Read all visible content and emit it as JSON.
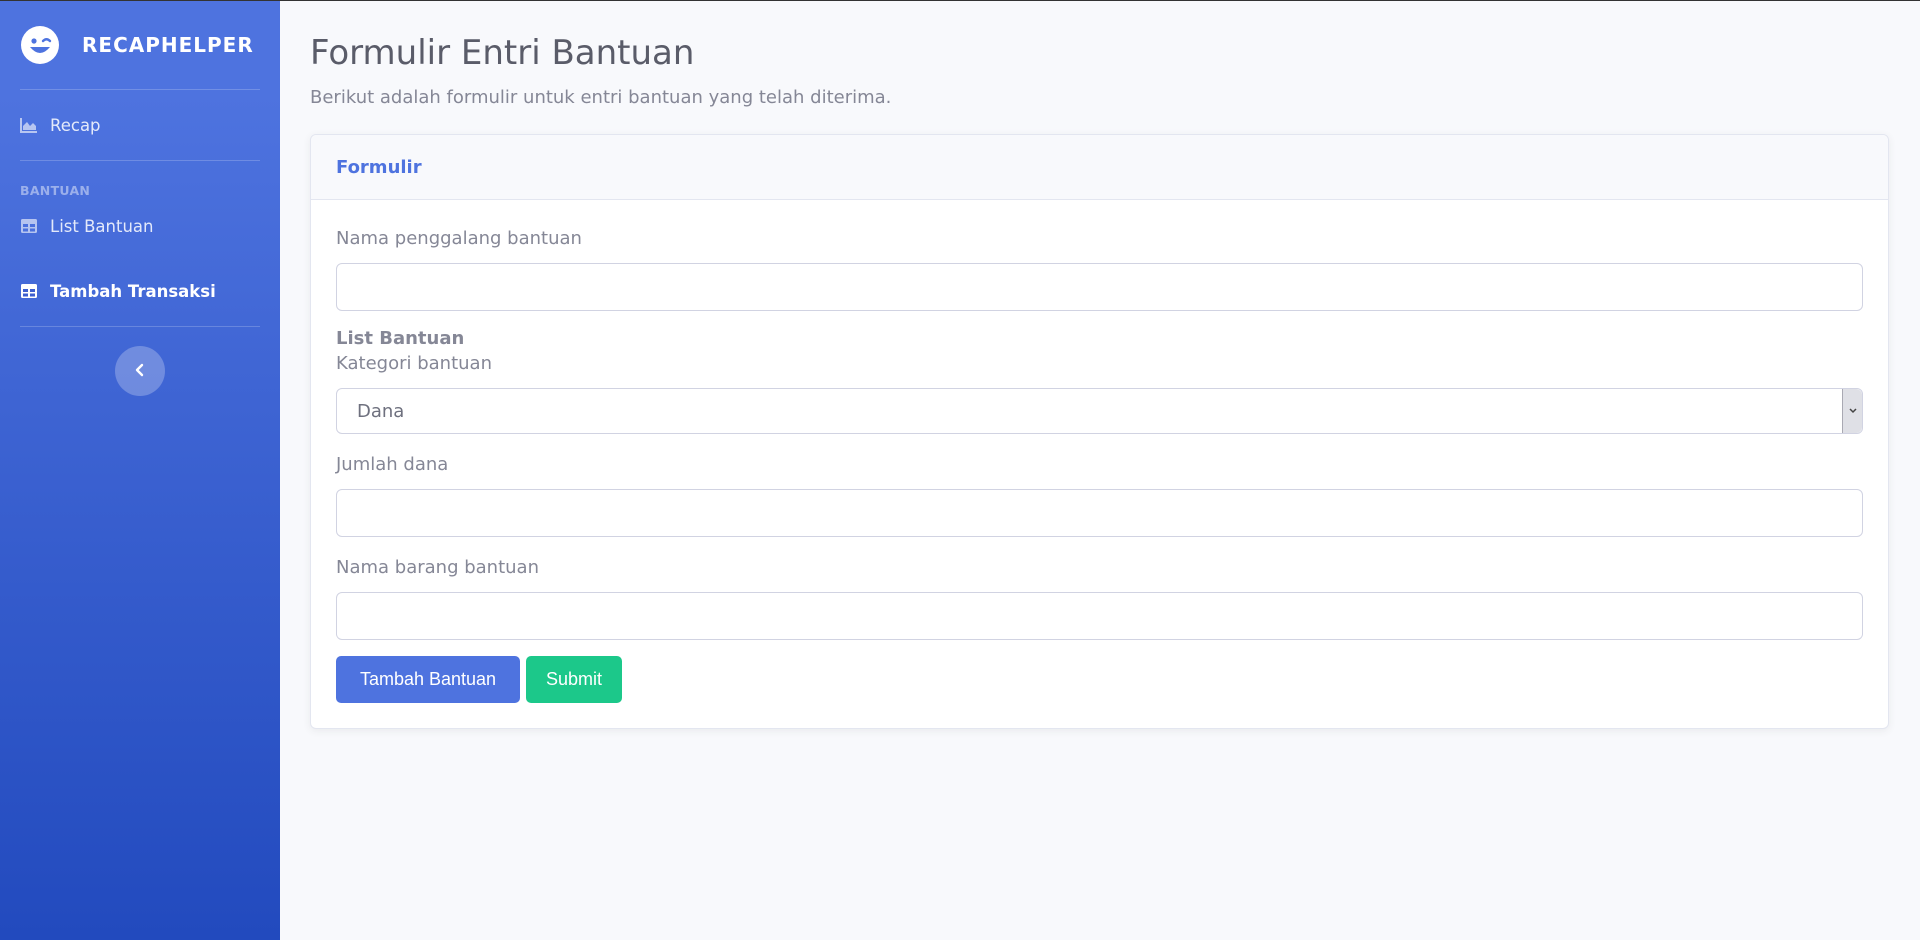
{
  "sidebar": {
    "brand": "RECAPHELPER",
    "brand_icon": "laugh-wink-icon",
    "recap_label": "Recap",
    "section_heading": "BANTUAN",
    "list_bantuan_label": "List Bantuan",
    "tambah_transaksi_label": "Tambah Transaksi",
    "toggle_icon": "chevron-left-icon"
  },
  "header": {
    "title": "Formulir Entri Bantuan",
    "subtitle": "Berikut adalah formulir untuk entri bantuan yang telah diterima."
  },
  "card": {
    "title": "Formulir",
    "fields": {
      "nama_penggalang_label": "Nama penggalang bantuan",
      "nama_penggalang_value": "",
      "list_bantuan_title": "List Bantuan",
      "kategori_label": "Kategori bantuan",
      "kategori_value": "Dana",
      "jumlah_dana_label": "Jumlah dana",
      "jumlah_dana_value": "",
      "nama_barang_label": "Nama barang bantuan",
      "nama_barang_value": ""
    },
    "buttons": {
      "add_label": "Tambah Bantuan",
      "submit_label": "Submit"
    }
  },
  "colors": {
    "primary": "#4e73df",
    "success": "#1cc88a",
    "sidebar_dark": "#224abe"
  }
}
